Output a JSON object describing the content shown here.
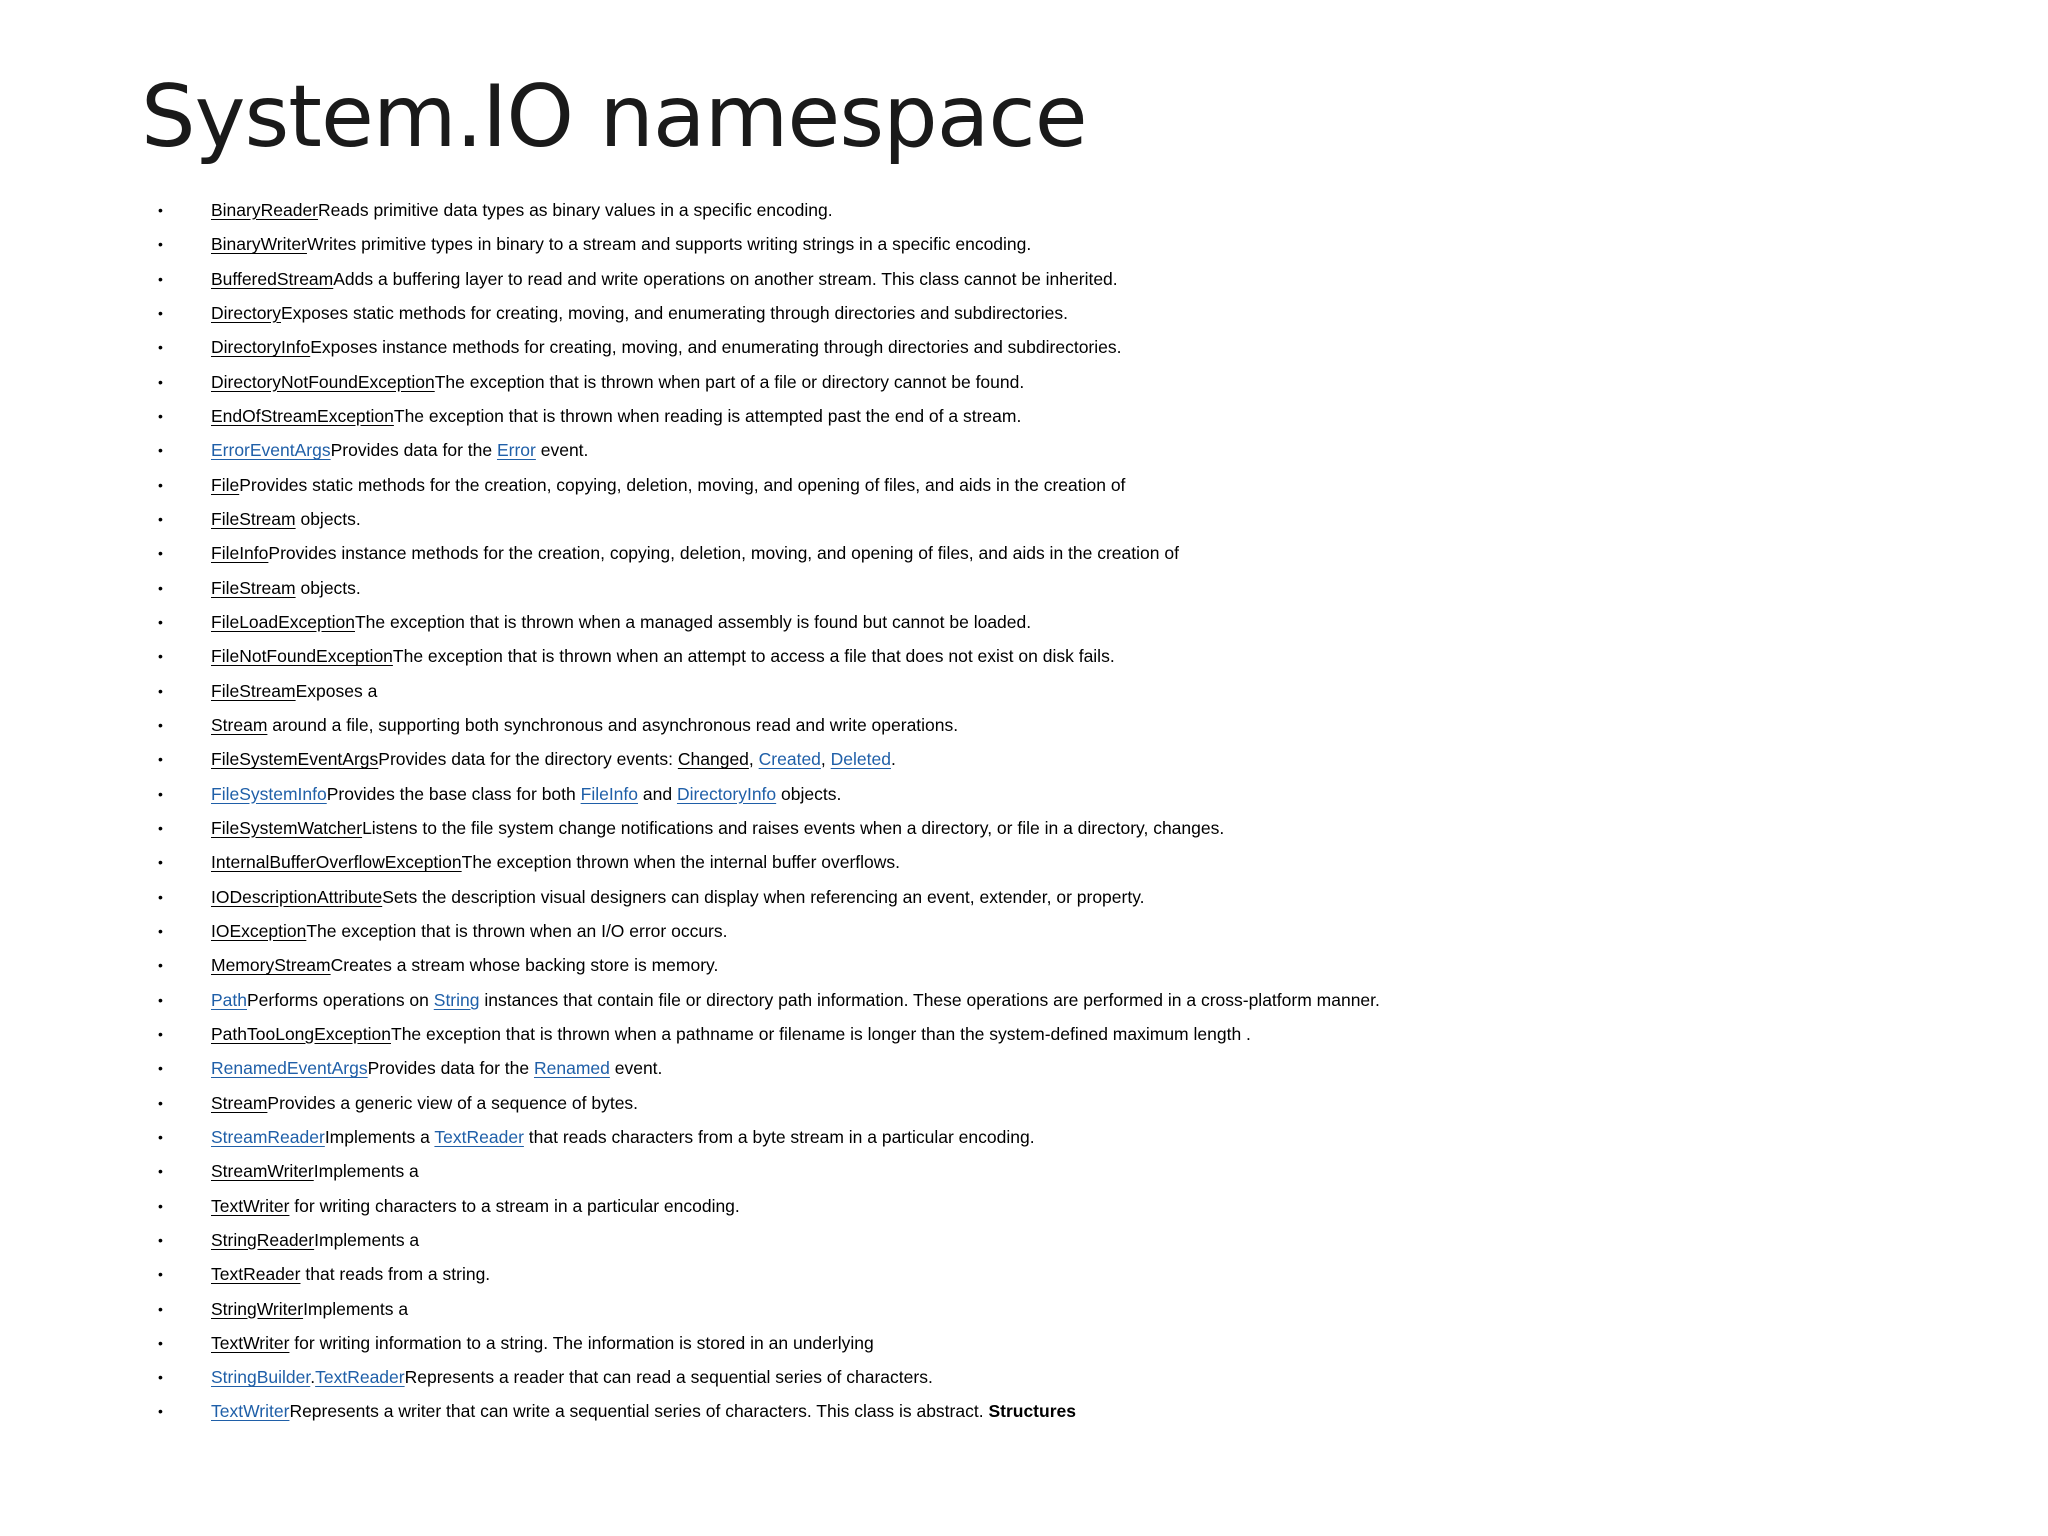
{
  "title": "System.IO namespace",
  "colors": {
    "link_blue": "#1f5fa8",
    "text": "#000000"
  },
  "items": [
    [
      {
        "t": "BinaryReader",
        "link": "plain"
      },
      {
        "t": "Reads primitive data types as binary values in a specific encoding."
      }
    ],
    [
      {
        "t": "BinaryWriter",
        "link": "plain"
      },
      {
        "t": "Writes primitive types in binary to a stream and supports writing strings in a specific encoding."
      }
    ],
    [
      {
        "t": "BufferedStream",
        "link": "plain"
      },
      {
        "t": "Adds a buffering layer to read and write operations on another stream. This class cannot be inherited."
      }
    ],
    [
      {
        "t": "Directory",
        "link": "plain"
      },
      {
        "t": "Exposes static methods for creating, moving, and enumerating through directories and subdirectories."
      }
    ],
    [
      {
        "t": "DirectoryInfo",
        "link": "plain"
      },
      {
        "t": "Exposes instance methods for creating, moving, and enumerating through directories and subdirectories."
      }
    ],
    [
      {
        "t": "DirectoryNotFoundException",
        "link": "plain"
      },
      {
        "t": "The exception that is thrown when part of a file or directory cannot be found."
      }
    ],
    [
      {
        "t": "EndOfStreamException",
        "link": "plain"
      },
      {
        "t": "The exception that is thrown when reading is attempted past the end of a stream."
      }
    ],
    [
      {
        "t": "ErrorEventArgs",
        "link": "blue"
      },
      {
        "t": "Provides data for the "
      },
      {
        "t": "Error",
        "link": "blue"
      },
      {
        "t": " event."
      }
    ],
    [
      {
        "t": "File",
        "link": "plain"
      },
      {
        "t": "Provides static methods for the creation, copying, deletion, moving, and opening of files, and aids in the creation of"
      }
    ],
    [
      {
        "t": "FileStream",
        "link": "plain"
      },
      {
        "t": " objects."
      }
    ],
    [
      {
        "t": "FileInfo",
        "link": "plain"
      },
      {
        "t": "Provides instance methods for the creation, copying, deletion, moving, and opening of files, and aids in the creation of"
      }
    ],
    [
      {
        "t": "FileStream",
        "link": "plain"
      },
      {
        "t": " objects."
      }
    ],
    [
      {
        "t": "FileLoadException",
        "link": "plain"
      },
      {
        "t": "The exception that is thrown when a managed assembly is found but cannot be loaded."
      }
    ],
    [
      {
        "t": "FileNotFoundException",
        "link": "plain"
      },
      {
        "t": "The exception that is thrown when an attempt to access a file that does not exist on disk fails."
      }
    ],
    [
      {
        "t": "FileStream",
        "link": "plain"
      },
      {
        "t": "Exposes a"
      }
    ],
    [
      {
        "t": "Stream",
        "link": "plain"
      },
      {
        "t": " around a file, supporting both synchronous and asynchronous read and write operations."
      }
    ],
    [
      {
        "t": "FileSystemEventArgs",
        "link": "plain"
      },
      {
        "t": "Provides data for the directory events: "
      },
      {
        "t": "Changed",
        "link": "plain"
      },
      {
        "t": ", "
      },
      {
        "t": "Created",
        "link": "blue"
      },
      {
        "t": ", "
      },
      {
        "t": "Deleted",
        "link": "blue"
      },
      {
        "t": "."
      }
    ],
    [
      {
        "t": "FileSystemInfo",
        "link": "blue"
      },
      {
        "t": "Provides the base class for both "
      },
      {
        "t": "FileInfo",
        "link": "blue"
      },
      {
        "t": " and "
      },
      {
        "t": "DirectoryInfo",
        "link": "blue"
      },
      {
        "t": " objects."
      }
    ],
    [
      {
        "t": "FileSystemWatcher",
        "link": "plain"
      },
      {
        "t": "Listens to the file system change notifications and raises events when a directory, or file in a directory, changes."
      }
    ],
    [
      {
        "t": "InternalBufferOverflowException",
        "link": "plain"
      },
      {
        "t": "The exception thrown when the internal buffer overflows."
      }
    ],
    [
      {
        "t": "IODescriptionAttribute",
        "link": "plain"
      },
      {
        "t": "Sets the description visual designers can display when referencing an event, extender, or property."
      }
    ],
    [
      {
        "t": "IOException",
        "link": "plain"
      },
      {
        "t": "The exception that is thrown when an I/O error occurs."
      }
    ],
    [
      {
        "t": "MemoryStream",
        "link": "plain"
      },
      {
        "t": "Creates a stream whose backing store is memory."
      }
    ],
    [
      {
        "t": "Path",
        "link": "blue"
      },
      {
        "t": "Performs operations on "
      },
      {
        "t": "String",
        "link": "blue"
      },
      {
        "t": " instances that contain file or directory path information. These operations are performed in a cross-platform manner."
      }
    ],
    [
      {
        "t": "PathTooLongException",
        "link": "plain"
      },
      {
        "t": "The exception that is thrown when a pathname or filename is longer than the system-defined maximum length ."
      }
    ],
    [
      {
        "t": "RenamedEventArgs",
        "link": "blue"
      },
      {
        "t": "Provides data for the "
      },
      {
        "t": "Renamed",
        "link": "blue"
      },
      {
        "t": " event."
      }
    ],
    [
      {
        "t": "Stream",
        "link": "plain"
      },
      {
        "t": "Provides a generic view of a sequence of bytes."
      }
    ],
    [
      {
        "t": "StreamReader",
        "link": "blue"
      },
      {
        "t": "Implements a "
      },
      {
        "t": "TextReader",
        "link": "blue"
      },
      {
        "t": " that reads characters from a byte stream in a particular encoding."
      }
    ],
    [
      {
        "t": "StreamWriter",
        "link": "plain"
      },
      {
        "t": "Implements a"
      }
    ],
    [
      {
        "t": "TextWriter",
        "link": "plain"
      },
      {
        "t": " for writing characters to a stream in a particular encoding."
      }
    ],
    [
      {
        "t": "StringReader",
        "link": "plain"
      },
      {
        "t": "Implements a"
      }
    ],
    [
      {
        "t": "TextReader",
        "link": "plain"
      },
      {
        "t": " that reads from a string."
      }
    ],
    [
      {
        "t": "StringWriter",
        "link": "plain"
      },
      {
        "t": "Implements a"
      }
    ],
    [
      {
        "t": "TextWriter",
        "link": "plain"
      },
      {
        "t": " for writing information to a string. The information is stored in an underlying"
      }
    ],
    [
      {
        "t": "StringBuilder",
        "link": "blue"
      },
      {
        "t": "."
      },
      {
        "t": "TextReader",
        "link": "blue"
      },
      {
        "t": "Represents a reader that can read a sequential series of characters."
      }
    ],
    [
      {
        "t": "TextWriter",
        "link": "blue"
      },
      {
        "t": "Represents a writer that can write a sequential series of characters. This class is abstract. "
      },
      {
        "t": "Structures",
        "bold": true
      }
    ]
  ]
}
